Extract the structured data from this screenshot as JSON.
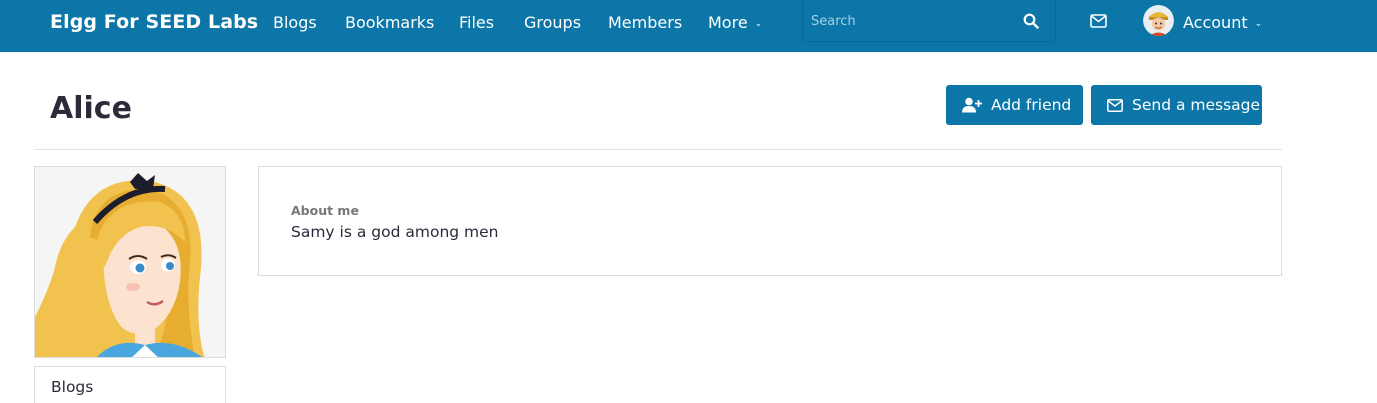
{
  "site": {
    "brand": "Elgg For SEED Labs"
  },
  "nav": {
    "items": [
      {
        "label": "Blogs"
      },
      {
        "label": "Bookmarks"
      },
      {
        "label": "Files"
      },
      {
        "label": "Groups"
      },
      {
        "label": "Members"
      }
    ],
    "more_label": "More",
    "chevron": "⌄"
  },
  "search": {
    "placeholder": "Search",
    "icon": "search-icon"
  },
  "topbar": {
    "mail_icon": "envelope-icon",
    "account_label": "Account",
    "color": "#0b76a7"
  },
  "profile": {
    "name": "Alice",
    "add_friend_label": "Add friend",
    "send_message_label": "Send a message",
    "about_label": "About me",
    "about_value": "Samy is a god among men"
  },
  "sidebar": {
    "items": [
      {
        "label": "Blogs"
      }
    ]
  }
}
